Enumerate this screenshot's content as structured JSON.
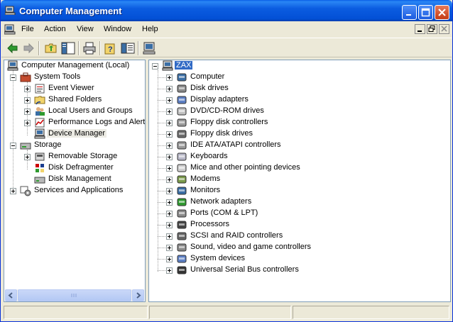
{
  "window": {
    "title": "Computer Management",
    "colors": {
      "titlebar": "#0a5fe6",
      "selection": "#316ac5",
      "face": "#ece9d8"
    }
  },
  "menu": {
    "items": [
      {
        "label": "File"
      },
      {
        "label": "Action"
      },
      {
        "label": "View"
      },
      {
        "label": "Window"
      },
      {
        "label": "Help"
      }
    ]
  },
  "toolbar": {
    "buttons": [
      {
        "icon": "back-arrow-icon"
      },
      {
        "icon": "forward-arrow-icon"
      },
      {
        "icon": "up-folder-icon"
      },
      {
        "icon": "show-hide-tree-icon"
      },
      {
        "icon": "print-icon"
      },
      {
        "icon": "help-icon"
      },
      {
        "icon": "properties-icon"
      },
      {
        "icon": "computer-icon"
      }
    ]
  },
  "left_tree": {
    "root": "Computer Management (Local)",
    "system_tools": "System Tools",
    "event_viewer": "Event Viewer",
    "shared_folders": "Shared Folders",
    "local_users": "Local Users and Groups",
    "perf_logs": "Performance Logs and Alerts",
    "device_manager": "Device Manager",
    "storage": "Storage",
    "removable_storage": "Removable Storage",
    "disk_defrag": "Disk Defragmenter",
    "disk_management": "Disk Management",
    "services_apps": "Services and Applications"
  },
  "right_tree": {
    "root": "ZAX",
    "devices": [
      {
        "label": "Computer",
        "icon": "computer-icon"
      },
      {
        "label": "Disk drives",
        "icon": "disk-drive-icon"
      },
      {
        "label": "Display adapters",
        "icon": "display-adapter-icon"
      },
      {
        "label": "DVD/CD-ROM drives",
        "icon": "cdrom-icon"
      },
      {
        "label": "Floppy disk controllers",
        "icon": "controller-icon"
      },
      {
        "label": "Floppy disk drives",
        "icon": "floppy-icon"
      },
      {
        "label": "IDE ATA/ATAPI controllers",
        "icon": "controller-icon"
      },
      {
        "label": "Keyboards",
        "icon": "keyboard-icon"
      },
      {
        "label": "Mice and other pointing devices",
        "icon": "mouse-icon"
      },
      {
        "label": "Modems",
        "icon": "modem-icon"
      },
      {
        "label": "Monitors",
        "icon": "monitor-icon"
      },
      {
        "label": "Network adapters",
        "icon": "network-adapter-icon"
      },
      {
        "label": "Ports (COM & LPT)",
        "icon": "port-icon"
      },
      {
        "label": "Processors",
        "icon": "processor-icon"
      },
      {
        "label": "SCSI and RAID controllers",
        "icon": "scsi-icon"
      },
      {
        "label": "Sound, video and game controllers",
        "icon": "sound-icon"
      },
      {
        "label": "System devices",
        "icon": "system-device-icon"
      },
      {
        "label": "Universal Serial Bus controllers",
        "icon": "usb-icon"
      }
    ]
  }
}
